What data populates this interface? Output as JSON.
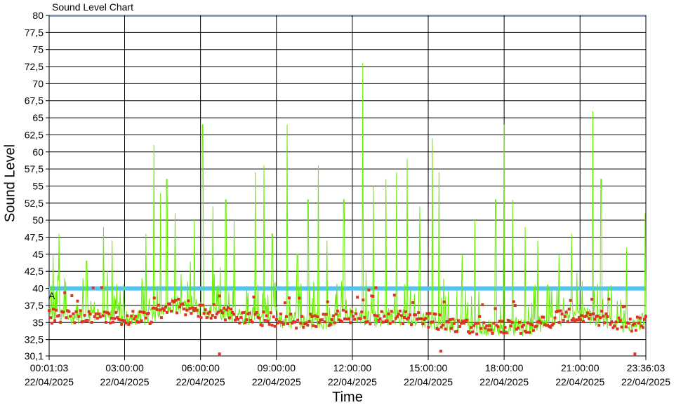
{
  "chart_data": {
    "type": "line",
    "title": "Sound Level Chart",
    "xlabel": "Time",
    "ylabel": "Sound Level",
    "ylim": [
      30.1,
      80
    ],
    "yticks": [
      "80",
      "77,5",
      "75",
      "72,5",
      "70",
      "67,5",
      "65",
      "62,5",
      "60",
      "57,5",
      "55",
      "52,5",
      "50",
      "47,5",
      "45",
      "42,5",
      "40",
      "37,5",
      "35",
      "32,5",
      "30,1"
    ],
    "xticks": [
      {
        "time": "00:01:03",
        "date": "22/04/2025"
      },
      {
        "time": "03:00:00",
        "date": "22/04/2025"
      },
      {
        "time": "06:00:00",
        "date": "22/04/2025"
      },
      {
        "time": "09:00:00",
        "date": "22/04/2025"
      },
      {
        "time": "12:00:00",
        "date": "22/04/2025"
      },
      {
        "time": "15:00:00",
        "date": "22/04/2025"
      },
      {
        "time": "18:00:00",
        "date": "22/04/2025"
      },
      {
        "time": "21:00:00",
        "date": "22/04/2025"
      },
      {
        "time": "23:36:03",
        "date": "22/04/2025"
      }
    ],
    "threshold": {
      "value": 40,
      "label": "A",
      "color": "#4fc3f7"
    },
    "series": [
      {
        "color": "#66ee00",
        "x": [
          "00:10",
          "00:25",
          "00:40",
          "01:30",
          "02:10",
          "02:30",
          "03:50",
          "04:10",
          "04:25",
          "04:40",
          "05:00",
          "05:30",
          "05:45",
          "06:05",
          "06:30",
          "07:00",
          "07:20",
          "08:10",
          "08:30",
          "08:50",
          "09:25",
          "09:50",
          "10:15",
          "10:40",
          "11:00",
          "11:40",
          "12:25",
          "12:50",
          "13:20",
          "13:45",
          "14:10",
          "14:40",
          "15:10",
          "15:25",
          "16:20",
          "16:50",
          "17:40",
          "18:00",
          "18:20",
          "18:50",
          "19:20",
          "20:10",
          "20:40",
          "21:30",
          "21:50",
          "22:50",
          "23:35"
        ],
        "y": [
          45,
          48,
          41,
          44,
          49,
          47,
          48,
          61,
          54,
          56,
          51,
          41,
          50,
          64,
          52,
          53,
          50,
          57,
          58,
          48,
          64,
          45,
          53,
          58,
          47,
          53,
          73,
          55,
          56,
          57,
          59,
          52,
          62,
          57,
          45,
          50,
          53,
          64,
          53,
          49,
          47,
          45,
          48,
          66,
          56,
          46,
          51
        ]
      },
      {
        "color": "#dd3322",
        "x": [
          "00:01:03",
          "01:00",
          "02:00",
          "03:00",
          "04:00",
          "05:00",
          "06:00",
          "07:00",
          "08:00",
          "09:00",
          "10:00",
          "11:00",
          "12:00",
          "13:00",
          "14:00",
          "15:00",
          "16:00",
          "17:00",
          "18:00",
          "19:00",
          "20:00",
          "21:00",
          "22:00",
          "23:00",
          "23:36:03"
        ],
        "y": [
          36,
          35.8,
          36.2,
          35.6,
          35.9,
          37.5,
          36.8,
          36.4,
          35.6,
          35.4,
          35.2,
          35.3,
          36.1,
          35.5,
          35.8,
          35.4,
          34.6,
          34.2,
          34.3,
          34.2,
          35.5,
          36.3,
          35.4,
          34.4,
          35.5
        ]
      }
    ]
  }
}
